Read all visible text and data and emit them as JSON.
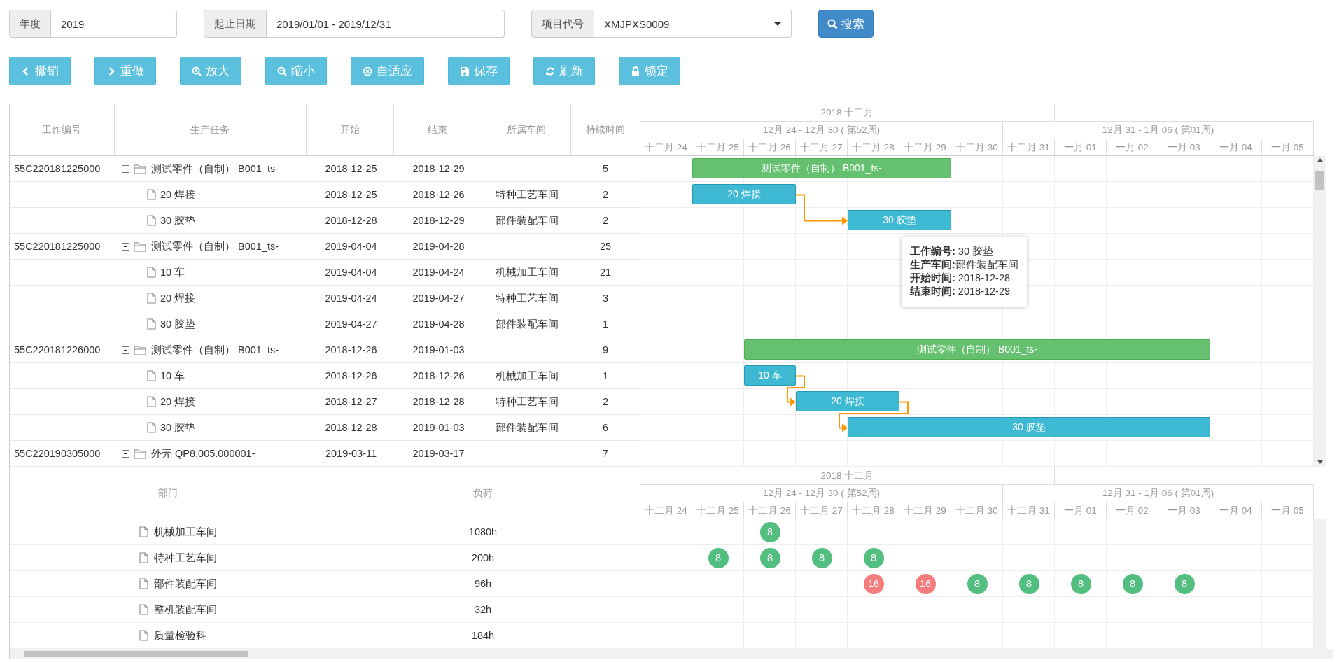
{
  "filters": [
    {
      "label": "年度",
      "value": "2019",
      "kind": "text"
    },
    {
      "label": "起止日期",
      "value": "2019/01/01 - 2019/12/31",
      "kind": "text"
    },
    {
      "label": "项目代号",
      "value": "XMJPXS0009",
      "kind": "select"
    }
  ],
  "search_button": "搜索",
  "toolbar": [
    {
      "label": "撤销"
    },
    {
      "label": "重做"
    },
    {
      "label": "放大"
    },
    {
      "label": "缩小"
    },
    {
      "label": "自适应"
    },
    {
      "label": "保存"
    },
    {
      "label": "刷新"
    },
    {
      "label": "锁定"
    }
  ],
  "task_grid": {
    "columns": [
      "工作编号",
      "生产任务",
      "开始",
      "结束",
      "所属车间",
      "持续时间"
    ],
    "rows": [
      {
        "id": "55C220181225000",
        "name": "测试零件（自制） B001_ts-",
        "start": "2018-12-25",
        "end": "2018-12-29",
        "duration": "5",
        "expanded": true,
        "bar": {
          "label": "测试零件（自制） B001_ts-"
        },
        "children": [
          {
            "name": "20 焊接",
            "start": "2018-12-25",
            "end": "2018-12-26",
            "workshop": "特种工艺车间",
            "duration": "2",
            "bar": {
              "label": "20 焊接",
              "linked_from_previous": false
            }
          },
          {
            "name": "30 胶垫",
            "start": "2018-12-28",
            "end": "2018-12-29",
            "workshop": "部件装配车间",
            "duration": "2",
            "bar": {
              "label": "30 胶垫",
              "linked_from_previous": true
            }
          }
        ]
      },
      {
        "id": "55C220181225000",
        "name": "测试零件（自制） B001_ts-",
        "start": "2019-04-04",
        "end": "2019-04-28",
        "duration": "25",
        "expanded": true,
        "children": [
          {
            "name": "10 车",
            "start": "2019-04-04",
            "end": "2019-04-24",
            "workshop": "机械加工车间",
            "duration": "21"
          },
          {
            "name": "20 焊接",
            "start": "2019-04-24",
            "end": "2019-04-27",
            "workshop": "特种工艺车间",
            "duration": "3"
          },
          {
            "name": "30 胶垫",
            "start": "2019-04-27",
            "end": "2019-04-28",
            "workshop": "部件装配车间",
            "duration": "1"
          }
        ]
      },
      {
        "id": "55C220181226000",
        "name": "测试零件（自制） B001_ts-",
        "start": "2018-12-26",
        "end": "2019-01-03",
        "duration": "9",
        "expanded": true,
        "bar": {
          "label": "测试零件（自制） B001_ts-"
        },
        "children": [
          {
            "name": "10 车",
            "start": "2018-12-26",
            "end": "2018-12-26",
            "workshop": "机械加工车间",
            "duration": "1",
            "bar": {
              "label": "10 车",
              "linked_from_previous": false
            }
          },
          {
            "name": "20 焊接",
            "start": "2018-12-27",
            "end": "2018-12-28",
            "workshop": "特种工艺车间",
            "duration": "2",
            "bar": {
              "label": "20 焊接",
              "linked_from_previous": true
            }
          },
          {
            "name": "30 胶垫",
            "start": "2018-12-28",
            "end": "2019-01-03",
            "workshop": "部件装配车间",
            "duration": "6",
            "bar": {
              "label": "30 胶垫",
              "linked_from_previous": true
            }
          }
        ]
      },
      {
        "id": "55C220190305000",
        "name": "外壳 QP8.005.000001-",
        "start": "2019-03-11",
        "end": "2019-03-17",
        "duration": "7",
        "expanded": true,
        "children": []
      }
    ]
  },
  "timeline": {
    "month": "2018 十二月",
    "weeks": [
      {
        "label": "12月 24 - 12月 30 ( 第52周)"
      },
      {
        "label": "12月 31 - 1月 06 ( 第01周)"
      }
    ],
    "days": [
      "十二月 24",
      "十二月 25",
      "十二月 26",
      "十二月 27",
      "十二月 28",
      "十二月 29",
      "十二月 30",
      "十二月 31",
      "一月 01",
      "一月 02",
      "一月 03",
      "一月 04",
      "一月 05"
    ]
  },
  "tooltip": {
    "lines": [
      "**工作编号:** 30 胶垫",
      "**生产车间:**部件装配车间",
      "**开始时间:** 2018-12-28",
      "**结束时间:** 2018-12-29"
    ]
  },
  "load_grid": {
    "columns": [
      "部门",
      "负荷"
    ],
    "timeline": {
      "month": "2018 十二月",
      "weeks": [
        {
          "label": "12月 24 - 12月 30 ( 第52周)"
        },
        {
          "label": "12月 31 - 1月 06 ( 第01周)"
        }
      ],
      "days": [
        "十二月 24",
        "十二月 25",
        "十二月 26",
        "十二月 27",
        "十二月 28",
        "十二月 29",
        "十二月 30",
        "十二月 31",
        "一月 01",
        "一月 02",
        "一月 03",
        "一月 04",
        "一月 05"
      ]
    },
    "rows": [
      {
        "department": "机械加工车间",
        "load": "1080h",
        "cells": [
          null,
          null,
          {
            "value": "8",
            "color": "#52be80"
          },
          null,
          null,
          null,
          null,
          null,
          null,
          null,
          null,
          null,
          null
        ]
      },
      {
        "department": "特种工艺车间",
        "load": "200h",
        "cells": [
          null,
          {
            "value": "8",
            "color": "#52be80"
          },
          {
            "value": "8",
            "color": "#52be80"
          },
          {
            "value": "8",
            "color": "#52be80"
          },
          {
            "value": "8",
            "color": "#52be80"
          },
          null,
          null,
          null,
          null,
          null,
          null,
          null,
          null
        ]
      },
      {
        "department": "部件装配车间",
        "load": "96h",
        "cells": [
          null,
          null,
          null,
          null,
          {
            "value": "16",
            "color": "#f47c7c"
          },
          {
            "value": "16",
            "color": "#f47c7c"
          },
          {
            "value": "8",
            "color": "#52be80"
          },
          {
            "value": "8",
            "color": "#52be80"
          },
          {
            "value": "8",
            "color": "#52be80"
          },
          {
            "value": "8",
            "color": "#52be80"
          },
          {
            "value": "8",
            "color": "#52be80"
          },
          null,
          null
        ]
      },
      {
        "department": "整机装配车间",
        "load": "32h",
        "cells": [
          null,
          null,
          null,
          null,
          null,
          null,
          null,
          null,
          null,
          null,
          null,
          null,
          null
        ]
      },
      {
        "department": "质量检验科",
        "load": "184h",
        "cells": [
          null,
          null,
          null,
          null,
          null,
          null,
          null,
          null,
          null,
          null,
          null,
          null,
          null
        ]
      }
    ]
  }
}
